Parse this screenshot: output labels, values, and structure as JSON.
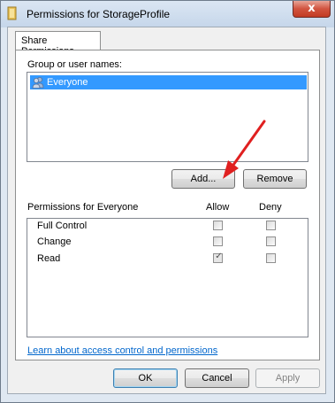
{
  "window": {
    "title": "Permissions for StorageProfile",
    "close_glyph": "x"
  },
  "tabs": [
    {
      "label": "Share Permissions"
    }
  ],
  "group_section": {
    "label": "Group or user names:",
    "items": [
      {
        "name": "Everyone",
        "icon": "users-icon",
        "selected": true
      }
    ]
  },
  "buttons": {
    "add": "Add...",
    "remove": "Remove",
    "ok": "OK",
    "cancel": "Cancel",
    "apply": "Apply"
  },
  "permissions": {
    "label": "Permissions for Everyone",
    "allow_header": "Allow",
    "deny_header": "Deny",
    "rows": [
      {
        "name": "Full Control",
        "allow": false,
        "deny": false
      },
      {
        "name": "Change",
        "allow": false,
        "deny": false
      },
      {
        "name": "Read",
        "allow": true,
        "deny": false
      }
    ]
  },
  "link": "Learn about access control and permissions",
  "colors": {
    "selection": "#3399ff",
    "link": "#0066cc",
    "annotation_arrow": "#e02020"
  }
}
